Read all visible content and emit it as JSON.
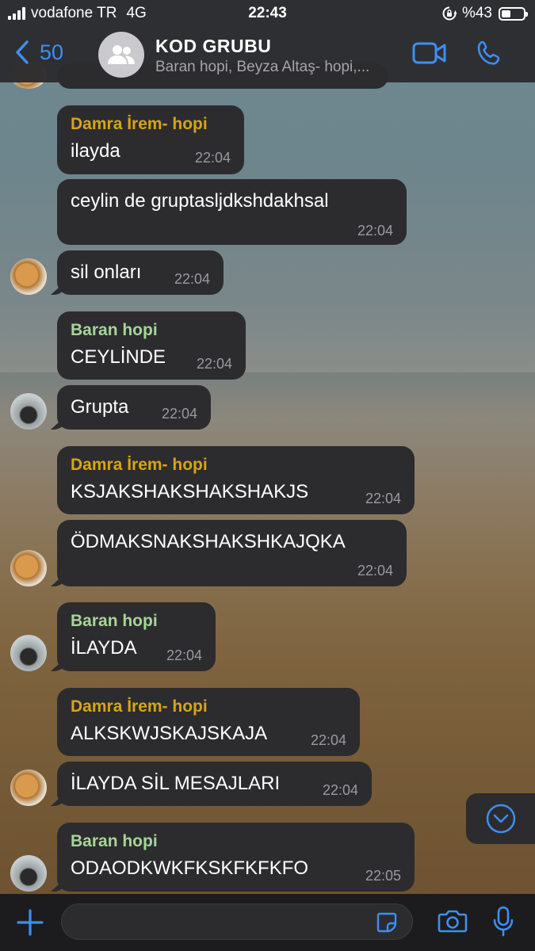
{
  "status_bar": {
    "carrier": "vodafone TR",
    "network": "4G",
    "time": "22:43",
    "battery": "%43"
  },
  "header": {
    "back_count": "50",
    "title": "KOD GRUBU",
    "subtitle": "Baran hopi, Beyza Altaş- hopi,..."
  },
  "messages": [
    {
      "sender": "Damra İrem- hopi",
      "text": "ilayda",
      "time": "22:04"
    },
    {
      "sender": "",
      "text": "ceylin de gruptasljdkshdakhsal",
      "time": "22:04"
    },
    {
      "sender": "",
      "text": "sil onları",
      "time": "22:04"
    },
    {
      "sender": "Baran hopi",
      "text": "CEYLİNDE",
      "time": "22:04"
    },
    {
      "sender": "",
      "text": "Grupta",
      "time": "22:04"
    },
    {
      "sender": "Damra İrem- hopi",
      "text": "KSJAKSHAKSHAKSHAKJS",
      "time": "22:04"
    },
    {
      "sender": "",
      "text": "ÖDMAKSNAKSHAKSHKAJQKA",
      "time": "22:04"
    },
    {
      "sender": "Baran hopi",
      "text": "İLAYDA",
      "time": "22:04"
    },
    {
      "sender": "Damra İrem- hopi",
      "text": "ALKSKWJSKAJSKAJA",
      "time": "22:04"
    },
    {
      "sender": "",
      "text": "İLAYDA SİL MESAJLARI",
      "time": "22:04"
    },
    {
      "sender": "Baran hopi",
      "text": "ODAODKWKFKSKFKFKFO",
      "time": "22:05"
    }
  ],
  "colors": {
    "accent": "#3d8ff2",
    "sender_damra": "#d6a517",
    "sender_baran": "#a7d49a",
    "bubble": "#2c2c2e"
  },
  "icons": [
    "back-chevron-icon",
    "group-avatar-icon",
    "video-call-icon",
    "phone-icon",
    "scroll-down-icon",
    "plus-icon",
    "sticker-icon",
    "camera-icon",
    "microphone-icon"
  ]
}
